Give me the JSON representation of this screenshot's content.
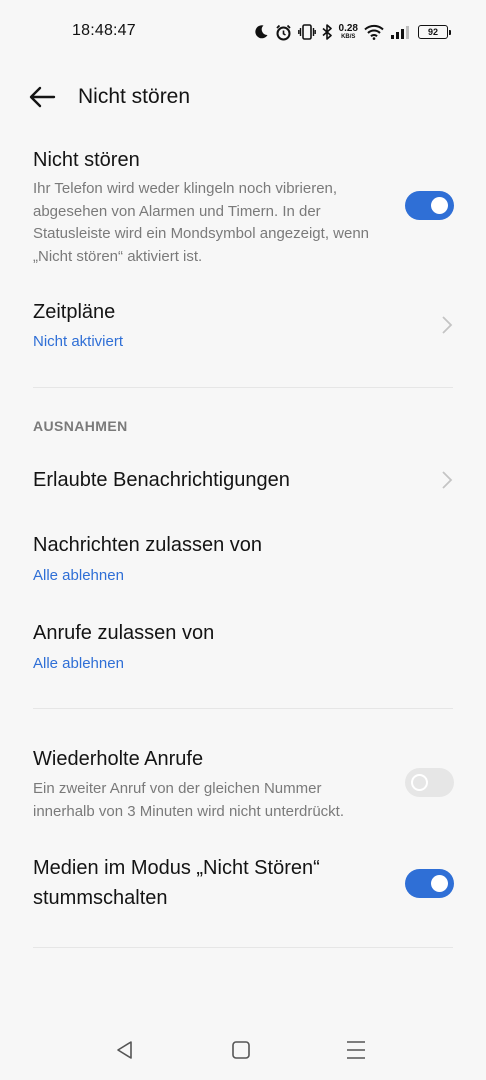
{
  "status_bar": {
    "time": "18:48:47",
    "net_speed_value": "0.28",
    "net_speed_unit": "KB/S",
    "battery": "92",
    "icons": [
      "moon-icon",
      "alarm-icon",
      "vibrate-icon",
      "bluetooth-icon",
      "wifi-icon",
      "signal-icon",
      "battery-icon"
    ]
  },
  "app_bar": {
    "title": "Nicht stören"
  },
  "dnd": {
    "title": "Nicht stören",
    "description": "Ihr Telefon wird weder klingeln noch vibrieren, abgesehen von Alarmen und Timern. In der Statusleiste wird ein Mondsymbol angezeigt, wenn „Nicht stören“ aktiviert ist.",
    "enabled": true
  },
  "schedules": {
    "title": "Zeitpläne",
    "value": "Nicht aktiviert"
  },
  "exceptions": {
    "header": "AUSNAHMEN",
    "allowed_notifications": "Erlaubte Benachrichtigungen",
    "messages": {
      "title": "Nachrichten zulassen von",
      "value": "Alle ablehnen"
    },
    "calls": {
      "title": "Anrufe zulassen von",
      "value": "Alle ablehnen"
    }
  },
  "repeated_calls": {
    "title": "Wiederholte Anrufe",
    "description": "Ein zweiter Anruf von der gleichen Nummer innerhalb von 3 Minuten wird nicht unterdrückt.",
    "enabled": false
  },
  "mute_media": {
    "title_line1": "Medien im Modus „Nicht Stören“",
    "title_line2": "stummschalten",
    "enabled": true
  },
  "colors": {
    "accent": "#2f6fd6",
    "background": "#f7f7f7",
    "secondary_text": "#7a7a7a"
  }
}
